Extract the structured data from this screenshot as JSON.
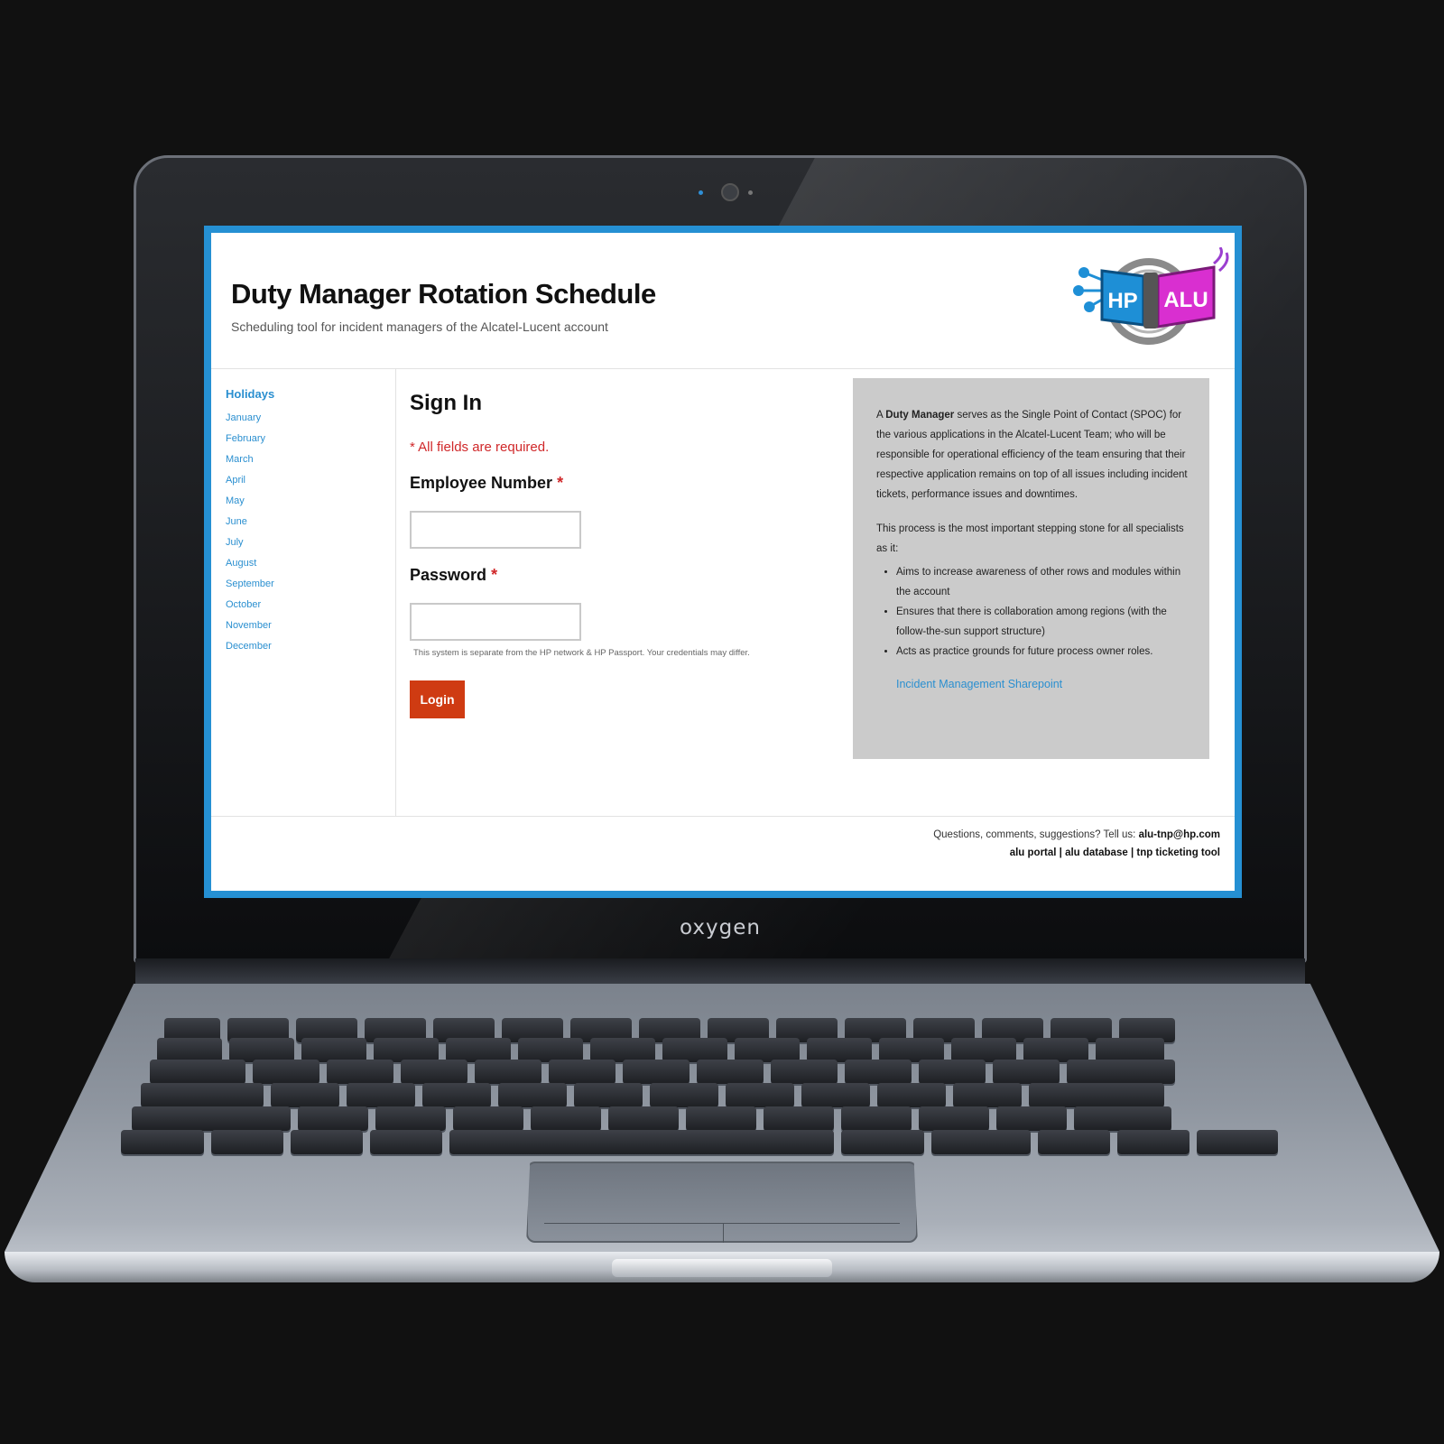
{
  "device": {
    "brand_label": "oxygen"
  },
  "header": {
    "title": "Duty Manager Rotation Schedule",
    "subtitle": "Scheduling tool for incident managers of the Alcatel-Lucent account",
    "logo": {
      "left_text": "HP",
      "right_text": "ALU",
      "colors": {
        "left": "#1e8fd6",
        "right": "#d92fd0"
      }
    }
  },
  "sidebar": {
    "heading": "Holidays",
    "months": [
      "January",
      "February",
      "March",
      "April",
      "May",
      "June",
      "July",
      "August",
      "September",
      "October",
      "November",
      "December"
    ]
  },
  "signin": {
    "title": "Sign In",
    "required_note": "* All fields are required.",
    "employee_label": "Employee Number",
    "employee_value": "",
    "password_label": "Password",
    "password_value": "",
    "required_marker": "*",
    "hint": "This system is separate from the HP network & HP Passport. Your credentials may differ.",
    "login_label": "Login"
  },
  "info": {
    "lead_prefix": "A ",
    "lead_bold": "Duty Manager",
    "lead_rest": " serves as the Single Point of Contact (SPOC) for the various applications in the Alcatel-Lucent Team; who will be responsible for operational efficiency of the team ensuring that their respective application remains on top of all issues including incident tickets, performance issues and downtimes.",
    "process_intro": "This process is the most important stepping stone for all specialists as it:",
    "bullets": [
      "Aims to increase awareness of other rows and modules within the account",
      "Ensures that there is collaboration among regions (with the follow-the-sun support structure)",
      "Acts as practice grounds for future process owner roles."
    ],
    "link_label": "Incident Management Sharepoint"
  },
  "footer": {
    "contact_prefix": "Questions, comments, suggestions? Tell us: ",
    "contact_email": "alu-tnp@hp.com",
    "links": [
      "alu portal",
      "alu database",
      "tnp ticketing tool"
    ],
    "separator": " | "
  },
  "colors": {
    "accent": "#2a8fd0",
    "error": "#d0282a",
    "login_button": "#cf3b12",
    "info_panel": "#cbcbcb",
    "screen_frame": "#2590d3"
  }
}
